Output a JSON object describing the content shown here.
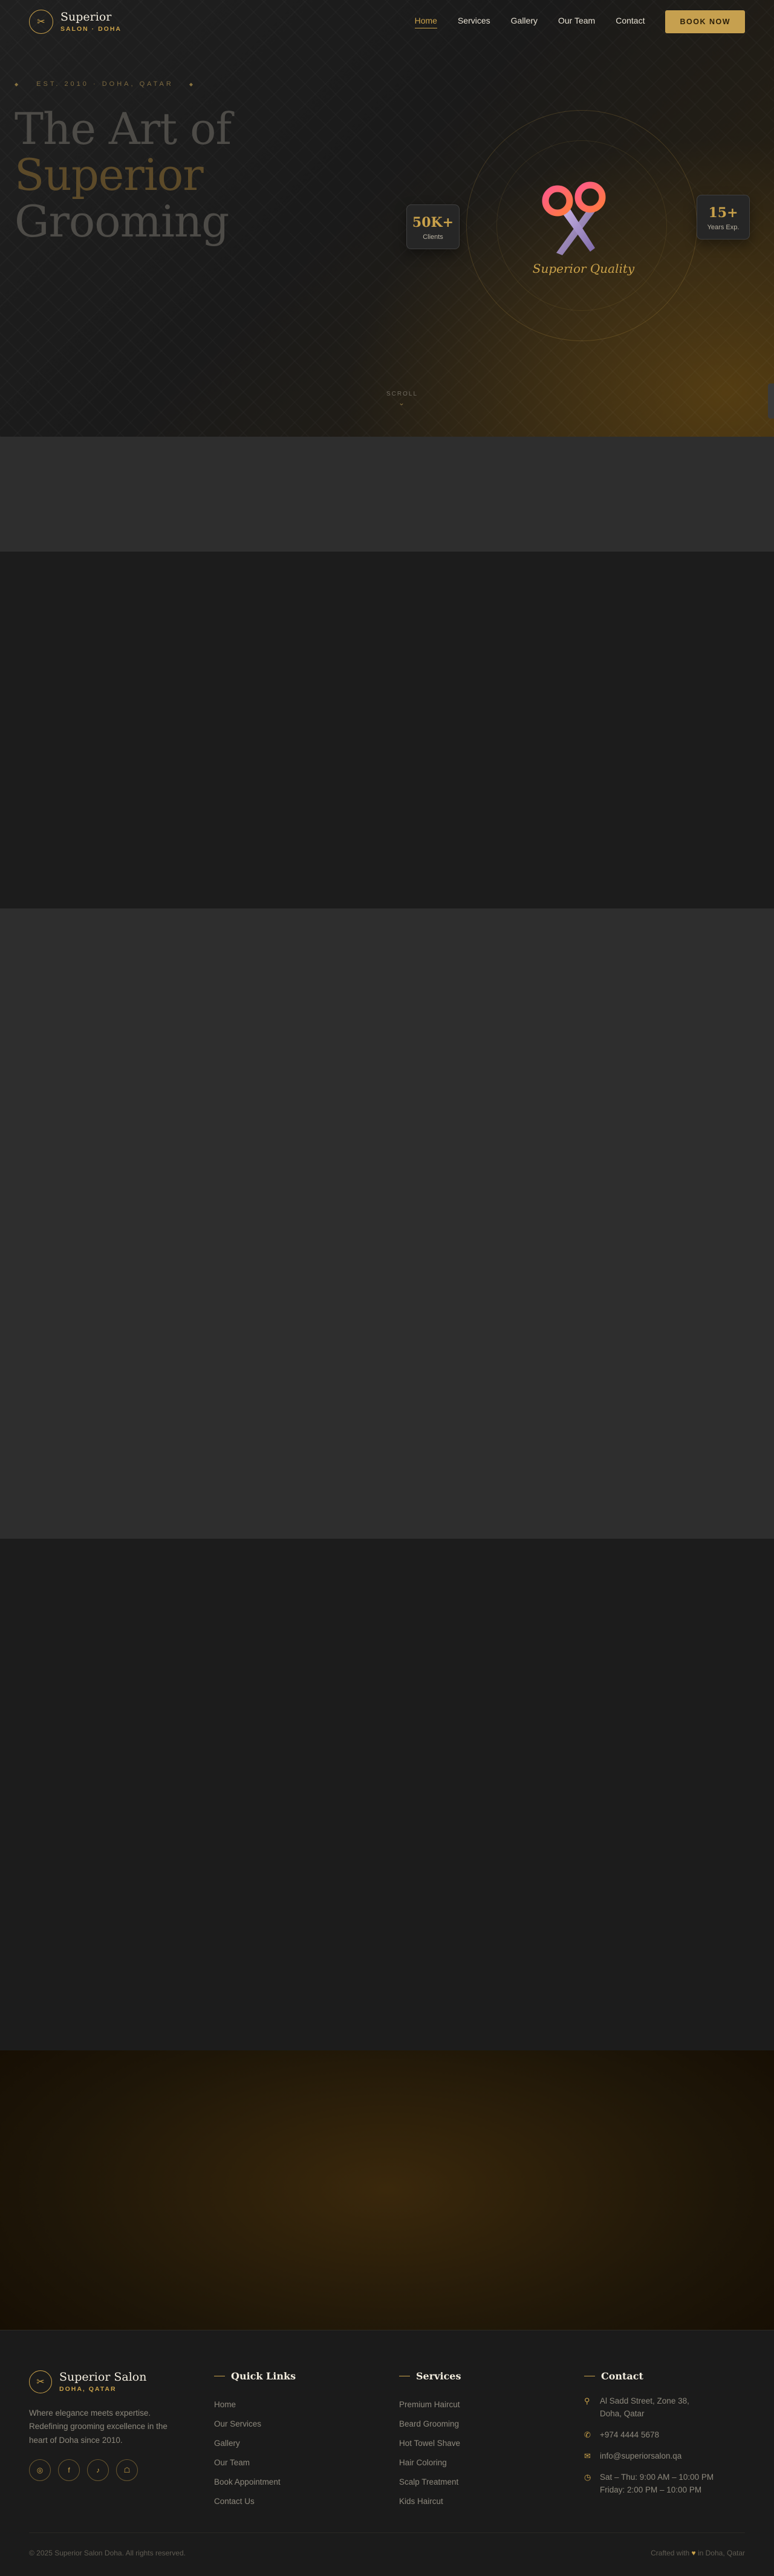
{
  "header": {
    "brand_name": "Superior",
    "brand_sub": "SALON · DOHA",
    "nav": [
      "Home",
      "Services",
      "Gallery",
      "Our Team",
      "Contact"
    ],
    "active_nav": "Home",
    "book_label": "BOOK NOW"
  },
  "hero": {
    "est": "EST. 2010 · DOHA, QATAR",
    "title_line1": "The Art of",
    "title_line2": "Superior",
    "title_line3": "Grooming",
    "badge_text": "Superior Quality",
    "stat_clients_num": "50K+",
    "stat_clients_label": "Clients",
    "stat_years_num": "15+",
    "stat_years_label": "Years Exp.",
    "scroll_label": "SCROLL"
  },
  "footer": {
    "brand_name": "Superior Salon",
    "brand_sub": "DOHA, QATAR",
    "description": "Where elegance meets expertise. Redefining grooming excellence in the heart of Doha since 2010.",
    "socials": [
      "instagram-icon",
      "facebook-icon",
      "tiktok-icon",
      "snapchat-icon"
    ],
    "quick_links_title": "Quick Links",
    "quick_links": [
      "Home",
      "Our Services",
      "Gallery",
      "Our Team",
      "Book Appointment",
      "Contact Us"
    ],
    "services_title": "Services",
    "services": [
      "Premium Haircut",
      "Beard Grooming",
      "Hot Towel Shave",
      "Hair Coloring",
      "Scalp Treatment",
      "Kids Haircut"
    ],
    "contact_title": "Contact",
    "address_line1": "Al Sadd Street, Zone 38,",
    "address_line2": "Doha, Qatar",
    "phone": "+974 4444 5678",
    "email": "info@superiorsalon.qa",
    "hours_line1": "Sat – Thu: 9:00 AM – 10:00 PM",
    "hours_line2": "Friday: 2:00 PM – 10:00 PM",
    "copyright": "© 2025 Superior Salon Doha. All rights reserved.",
    "crafted_prefix": "Crafted with",
    "crafted_suffix": "in Doha, Qatar"
  },
  "colors": {
    "accent": "#c9a14a",
    "background": "#1b1b1b",
    "section_alt": "#2e2e2e"
  }
}
